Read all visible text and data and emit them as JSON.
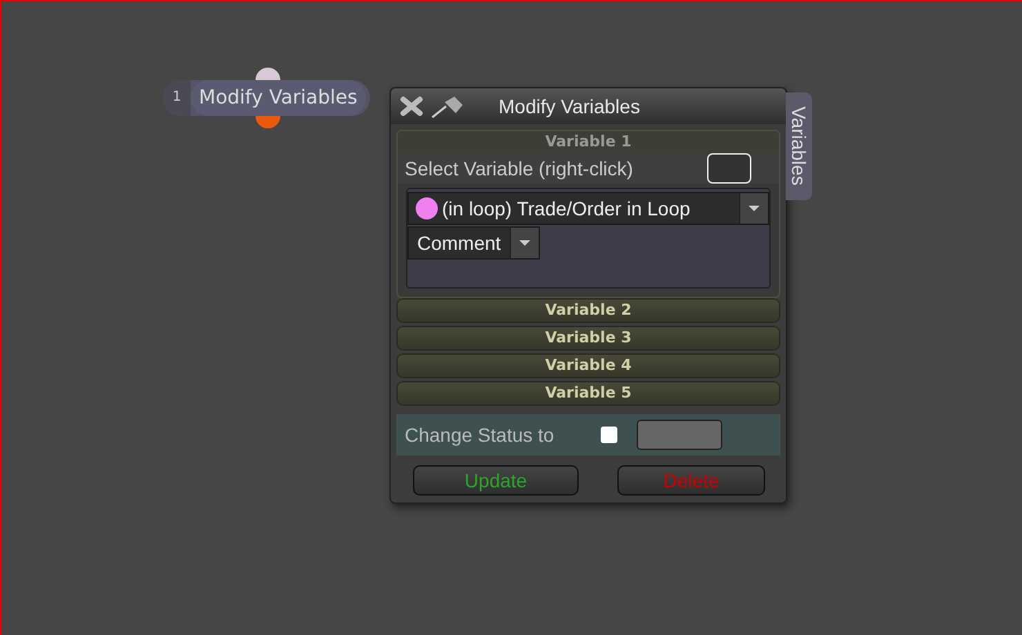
{
  "node": {
    "number": "1",
    "label": "Modify Variables"
  },
  "dialog": {
    "title": "Modify Variables",
    "side_tab": "Variables",
    "variables": [
      {
        "title": "Variable 1",
        "expanded": true,
        "select_label": "Select Variable (right-click)",
        "variable": {
          "label": "(in loop) Trade/Order in Loop",
          "color": "#f080f0"
        },
        "field": "Comment"
      },
      {
        "title": "Variable 2",
        "expanded": false
      },
      {
        "title": "Variable 3",
        "expanded": false
      },
      {
        "title": "Variable 4",
        "expanded": false
      },
      {
        "title": "Variable 5",
        "expanded": false
      }
    ],
    "status": {
      "label": "Change Status to",
      "checked": false
    },
    "buttons": [
      {
        "label": "Update",
        "kind": "update"
      },
      {
        "label": "Delete",
        "kind": "delete"
      }
    ]
  }
}
